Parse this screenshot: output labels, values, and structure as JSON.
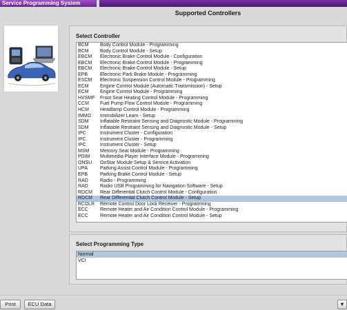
{
  "window": {
    "title": "Service Programming System"
  },
  "page_title": "Supported Controllers",
  "select_controller": {
    "label": "Select Controller",
    "selected_index": 26,
    "rows": [
      {
        "code": "BCM",
        "description": "Body Control Module - Programming"
      },
      {
        "code": "BCM",
        "description": "Body Control Module - Setup"
      },
      {
        "code": "EBCM",
        "description": "Electronic Brake Control Module - Configuration"
      },
      {
        "code": "EBCM",
        "description": "Electronic Brake Control Module - Programming"
      },
      {
        "code": "EBCM",
        "description": "Electronic Brake Control Module - Setup"
      },
      {
        "code": "EPB",
        "description": "Electronic Park Brake Module - Programming"
      },
      {
        "code": "ESCM",
        "description": "Electronic Suspension Control Module - Programming"
      },
      {
        "code": "ECM",
        "description": "Engine Control Module (Automatic Transmission) - Setup"
      },
      {
        "code": "ECM",
        "description": "Engine Control Module - Programming"
      },
      {
        "code": "HVSMF",
        "description": "Front Seat Heating Control Module - Programming"
      },
      {
        "code": "CCM",
        "description": "Fuel Pump Flow Control Module - Programming"
      },
      {
        "code": "HCM",
        "description": "Headlamp Control Module - Programming"
      },
      {
        "code": "IMMO",
        "description": "Immobilizer Learn - Setup"
      },
      {
        "code": "SDM",
        "description": "Inflatable Restraint Sensing and Diagnostic Module - Programming"
      },
      {
        "code": "SDM",
        "description": "Inflatable Restraint Sensing and Diagnostic Module - Setup"
      },
      {
        "code": "IPC",
        "description": "Instrument Cluster - Configuration"
      },
      {
        "code": "IPC",
        "description": "Instrument Cluster - Programming"
      },
      {
        "code": "IPC",
        "description": "Instrument Cluster - Setup"
      },
      {
        "code": "MSM",
        "description": "Memory Seat Module - Programming"
      },
      {
        "code": "PDIM",
        "description": "Multimedia Player Interface Module - Programming"
      },
      {
        "code": "ONSU",
        "description": "OnStar Module Setup & Service Activation"
      },
      {
        "code": "UPA",
        "description": "Parking Assist Control Module - Programming"
      },
      {
        "code": "EPB",
        "description": "Parking Brake Control Module - Setup"
      },
      {
        "code": "RAD",
        "description": "Radio - Programming"
      },
      {
        "code": "RAD",
        "description": "Radio USB Programming for Navigation Software - Setup"
      },
      {
        "code": "RDCM",
        "description": "Rear Differential Clutch Control Module - Configuration"
      },
      {
        "code": "RDCM",
        "description": "Rear Differential Clutch Control Module - Setup"
      },
      {
        "code": "RCDLR",
        "description": "Remote Control Door Lock Receiver - Programming"
      },
      {
        "code": "ECC",
        "description": "Remote Heater and Air Condition Control Module - Programming"
      },
      {
        "code": "ECC",
        "description": "Remote Heater and Air Condition Control Module - Setup"
      }
    ]
  },
  "select_programming_type": {
    "label": "Select Programming Type",
    "options": [
      "Normal",
      "VCI"
    ],
    "selected_index": 0
  },
  "buttons": {
    "print": "Print",
    "ecu_data": "ECU Data",
    "arrow": "▼"
  },
  "colors": {
    "selection": "#b4c6df",
    "title_bar": "#6b2496"
  }
}
